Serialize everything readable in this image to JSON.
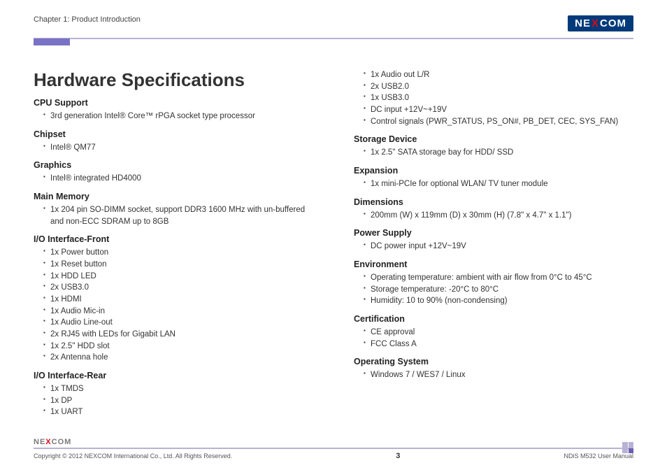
{
  "header": {
    "chapter": "Chapter 1: Product Introduction",
    "logo_l": "NE",
    "logo_x": "X",
    "logo_r": "COM"
  },
  "title": "Hardware Specifications",
  "left": [
    {
      "h": "CPU Support",
      "items": [
        "3rd generation Intel® Core™ rPGA socket type processor"
      ]
    },
    {
      "h": "Chipset",
      "items": [
        "Intel® QM77"
      ]
    },
    {
      "h": "Graphics",
      "items": [
        "Intel® integrated HD4000"
      ]
    },
    {
      "h": "Main Memory",
      "items": [
        "1x 204 pin SO-DIMM socket, support DDR3 1600 MHz with un-buffered and non-ECC SDRAM up to 8GB"
      ]
    },
    {
      "h": "I/O Interface-Front",
      "items": [
        "1x Power button",
        "1x Reset button",
        "1x HDD LED",
        "2x USB3.0",
        "1x HDMI",
        "1x Audio Mic-in",
        "1x Audio Line-out",
        "2x RJ45 with LEDs for Gigabit LAN",
        "1x 2.5\" HDD slot",
        "2x Antenna hole"
      ]
    },
    {
      "h": "I/O Interface-Rear",
      "items": [
        "1x TMDS",
        "1x DP",
        "1x UART"
      ]
    }
  ],
  "right_top_items": [
    "1x Audio out L/R",
    "2x USB2.0",
    "1x USB3.0",
    "DC input +12V~+19V",
    "Control signals (PWR_STATUS, PS_ON#, PB_DET, CEC, SYS_FAN)"
  ],
  "right": [
    {
      "h": "Storage Device",
      "items": [
        "1x 2.5\" SATA storage bay for HDD/ SSD"
      ]
    },
    {
      "h": "Expansion",
      "items": [
        "1x mini-PCIe for optional WLAN/ TV tuner module"
      ]
    },
    {
      "h": "Dimensions",
      "items": [
        "200mm (W) x 119mm (D) x 30mm (H) (7.8\" x 4.7\" x 1.1\")"
      ]
    },
    {
      "h": "Power Supply",
      "items": [
        "DC power input +12V~19V"
      ]
    },
    {
      "h": "Environment",
      "items": [
        "Operating temperature: ambient with air flow from 0°C to 45°C",
        "Storage temperature: -20°C to 80°C",
        "Humidity: 10 to 90% (non-condensing)"
      ]
    },
    {
      "h": "Certification",
      "items": [
        "CE approval",
        "FCC Class A"
      ]
    },
    {
      "h": "Operating System",
      "items": [
        "Windows 7 / WES7 / Linux"
      ]
    }
  ],
  "footer": {
    "logo_l": "NE",
    "logo_x": "X",
    "logo_r": "COM",
    "copyright": "Copyright © 2012 NEXCOM International Co., Ltd. All Rights Reserved.",
    "page": "3",
    "manual": "NDiS M532 User Manual"
  }
}
